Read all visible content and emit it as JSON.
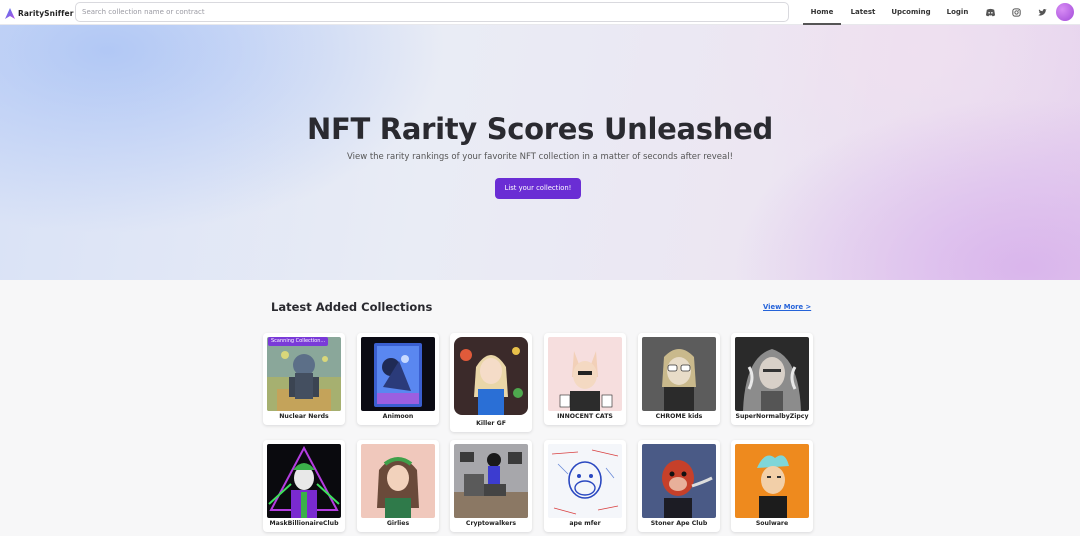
{
  "nav": {
    "brand": "RaritySniffer",
    "search_placeholder": "Search collection name or contract",
    "links": [
      "Home",
      "Latest",
      "Upcoming",
      "Login"
    ],
    "active_link": "Home",
    "icons": [
      "discord-icon",
      "instagram-icon",
      "twitter-icon"
    ]
  },
  "hero": {
    "title": "NFT Rarity Scores Unleashed",
    "subtitle": "View the rarity rankings of your favorite NFT collection in a matter of seconds after reveal!",
    "cta_label": "List your collection!",
    "cta_color": "#6a2dd4"
  },
  "latest": {
    "title": "Latest Added Collections",
    "view_more": "View More >",
    "scanning_badge": "Scanning Collection...",
    "collections": [
      "Nuclear Nerds",
      "Animoon",
      "Killer GF",
      "INNOCENT CATS",
      "CHROME kids",
      "SuperNormalbyZipcy",
      "MaskBillionaireClub",
      "Girlies",
      "Cryptowalkers",
      "ape mfer",
      "Stoner Ape Club",
      "Soulware"
    ]
  }
}
